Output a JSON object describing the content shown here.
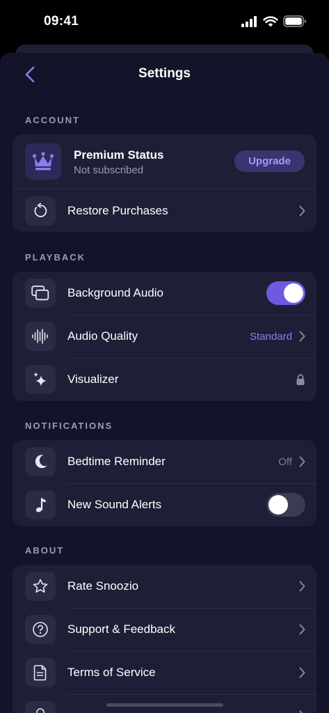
{
  "status_bar": {
    "time": "09:41"
  },
  "nav": {
    "title": "Settings"
  },
  "sections": {
    "account": {
      "label": "ACCOUNT",
      "premium": {
        "title": "Premium Status",
        "subtitle": "Not subscribed",
        "button": "Upgrade"
      },
      "restore": {
        "label": "Restore Purchases"
      }
    },
    "playback": {
      "label": "PLAYBACK",
      "background_audio": {
        "label": "Background Audio",
        "enabled": true
      },
      "audio_quality": {
        "label": "Audio Quality",
        "value": "Standard"
      },
      "visualizer": {
        "label": "Visualizer",
        "locked": true
      }
    },
    "notifications": {
      "label": "NOTIFICATIONS",
      "bedtime": {
        "label": "Bedtime Reminder",
        "value": "Off"
      },
      "new_sound": {
        "label": "New Sound Alerts",
        "enabled": false
      }
    },
    "about": {
      "label": "ABOUT",
      "rate": {
        "label": "Rate Snoozio"
      },
      "support": {
        "label": "Support & Feedback"
      },
      "terms": {
        "label": "Terms of Service"
      }
    }
  },
  "colors": {
    "accent": "#7158e2",
    "accent_text": "#8d7cf2",
    "sheet_bg": "#13142a",
    "card_bg": "#1e1f36"
  }
}
